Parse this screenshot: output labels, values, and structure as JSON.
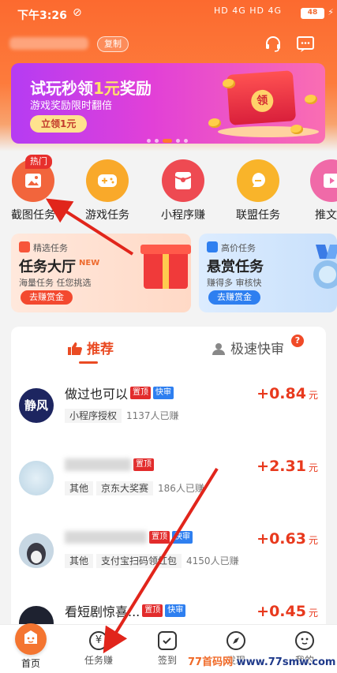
{
  "status_bar": {
    "time": "下午3:26",
    "network": "HD 4G HD 4G",
    "battery": "48"
  },
  "header": {
    "copy_label": "复制"
  },
  "banner": {
    "title_pre": "试玩秒领",
    "title_highlight": "1元",
    "title_post": "奖励",
    "subtitle": "游戏奖励限时翻倍",
    "button": "立领1元",
    "envelope_text": "领"
  },
  "categories": [
    {
      "label": "截图任务",
      "badge": "热门",
      "color": "#f2653c"
    },
    {
      "label": "游戏任务",
      "color": "#f9a92a"
    },
    {
      "label": "小程序赚",
      "color": "#ee4a52"
    },
    {
      "label": "联盟任务",
      "color": "#f9b42a"
    },
    {
      "label": "推文任",
      "color": "#f06aa8"
    }
  ],
  "feature_cards": [
    {
      "tag": "精选任务",
      "title": "任务大厅",
      "new": "NEW",
      "subtitle": "海量任务 任您挑选",
      "button": "去赚赏金"
    },
    {
      "tag": "高价任务",
      "title": "悬赏任务",
      "subtitle": "赚得多 审核快",
      "button": "去赚赏金"
    }
  ],
  "tabs": {
    "recommend": "推荐",
    "fast": "极速快审",
    "help": "?"
  },
  "tasks": [
    {
      "name": "做过也可以",
      "badges": [
        "置顶",
        "快审"
      ],
      "category": "小程序授权",
      "count": "1137人已赚",
      "price": "+0.84",
      "unit": "元",
      "avatar_text": "静风"
    },
    {
      "name": "",
      "badges": [
        "置顶"
      ],
      "category": "其他",
      "extra": "京东大奖赛",
      "count": "186人已赚",
      "price": "+2.31",
      "unit": "元"
    },
    {
      "name": "",
      "badges": [
        "置顶",
        "快审"
      ],
      "category": "其他",
      "extra": "支付宝扫码领红包",
      "count": "4150人已赚",
      "price": "+0.63",
      "unit": "元"
    },
    {
      "name": "看短剧惊喜...",
      "badges": [
        "置顶",
        "快审"
      ],
      "price": "+0.45",
      "unit": "元"
    }
  ],
  "tabbar": [
    {
      "label": "首页"
    },
    {
      "label": "任务赚",
      "glyph": "¥"
    },
    {
      "label": "签到"
    },
    {
      "label": "发现"
    },
    {
      "label": "我的"
    }
  ],
  "watermark": {
    "text_a": "77首码网",
    "text_b": "www.77smw.com"
  },
  "colors": {
    "brand": "#f47530",
    "price": "#e8391d",
    "top_badge": "#e22b2b",
    "fast_badge": "#2e7ff0"
  }
}
